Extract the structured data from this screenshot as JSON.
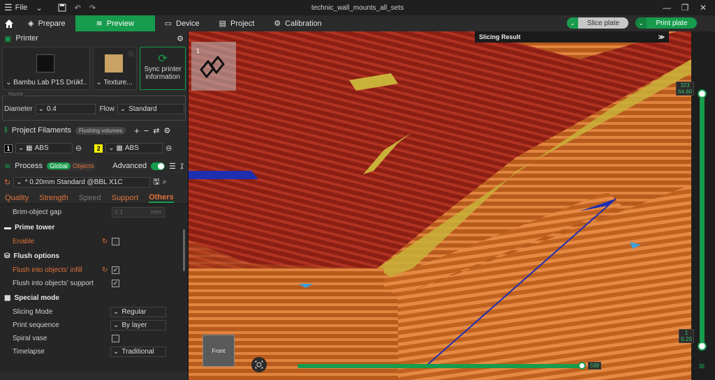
{
  "titlebar": {
    "menu_label": "File",
    "title": "technic_wall_mounts_all_sets"
  },
  "nav": {
    "tabs": [
      "Prepare",
      "Preview",
      "Device",
      "Project",
      "Calibration"
    ],
    "active": "Preview",
    "slice_label": "Slice plate",
    "print_label": "Print plate"
  },
  "printer": {
    "section_title": "Printer",
    "printer_name": "Bambu Lab P1S Drükf...",
    "plate_name": "Texture...",
    "sync_label_1": "Sync printer",
    "sync_label_2": "information",
    "nozzle_caption": "Nozzle",
    "diameter_label": "Diameter",
    "diameter_value": "0.4",
    "flow_label": "Flow",
    "flow_value": "Standard"
  },
  "filaments": {
    "title": "Project Filaments",
    "flushing_badge": "Flushing volumes",
    "items": [
      {
        "num": "1",
        "name": "ABS",
        "color": "#000000"
      },
      {
        "num": "2",
        "name": "ABS",
        "color": "#f4f000"
      }
    ]
  },
  "process": {
    "title": "Process",
    "global_label": "Global",
    "objects_label": "Objects",
    "advanced_label": "Advanced",
    "profile": "* 0.20mm Standard @BBL X1C",
    "subtabs": [
      "Quality",
      "Strength",
      "Speed",
      "Support",
      "Others"
    ],
    "active_subtab": "Others"
  },
  "options": {
    "brim_gap_label": "Brim-object gap",
    "brim_gap_value": "0.1",
    "brim_gap_unit": "mm",
    "prime_tower": "Prime tower",
    "enable_label": "Enable",
    "flush_options": "Flush options",
    "flush_infill": "Flush into objects' infill",
    "flush_support": "Flush into objects' support",
    "special_mode": "Special mode",
    "slicing_mode_label": "Slicing Mode",
    "slicing_mode_value": "Regular",
    "print_seq_label": "Print sequence",
    "print_seq_value": "By layer",
    "spiral_label": "Spiral vase",
    "timelapse_label": "Timelapse",
    "timelapse_value": "Traditional"
  },
  "viewport": {
    "slicing_result": "Slicing Result",
    "plate_number": "1",
    "view_cube": "Front",
    "layer_top": "323",
    "layer_top_height": "64.60",
    "layer_bottom": "1",
    "layer_bottom_height": "0.20",
    "move_value": "588"
  }
}
